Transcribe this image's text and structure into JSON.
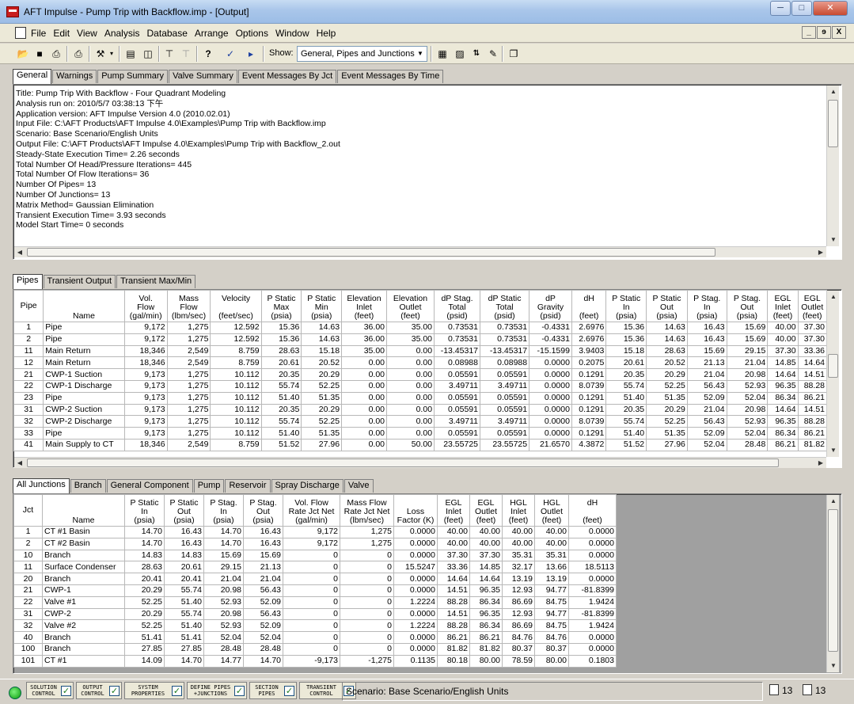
{
  "window": {
    "title": "AFT Impulse - Pump Trip with Backflow.imp - [Output]",
    "controls": [
      "─",
      "□",
      "✕"
    ]
  },
  "menu": [
    "File",
    "Edit",
    "View",
    "Analysis",
    "Database",
    "Arrange",
    "Options",
    "Window",
    "Help"
  ],
  "mdi_controls": [
    "_",
    "ɘ",
    "X"
  ],
  "toolbar": {
    "show_label": "Show:",
    "show_value": "General, Pipes and Junctions"
  },
  "general_tabs": [
    "General",
    "Warnings",
    "Pump Summary",
    "Valve Summary",
    "Event Messages By Jct",
    "Event Messages By Time"
  ],
  "general_text": [
    "Title: Pump Trip With Backflow - Four Quadrant Modeling",
    "Analysis run on: 2010/5/7 03:38:13 下午",
    "Application version: AFT Impulse Version 4.0 (2010.02.01)",
    "Input File: C:\\AFT Products\\AFT Impulse 4.0\\Examples\\Pump Trip with Backflow.imp",
    "Scenario: Base Scenario/English Units",
    "Output File: C:\\AFT Products\\AFT Impulse 4.0\\Examples\\Pump Trip with Backflow_2.out",
    "",
    "Steady-State Execution Time= 2.26 seconds",
    "Total Number Of Head/Pressure Iterations= 445",
    "Total Number Of Flow Iterations= 36",
    "Number Of Pipes= 13",
    "Number Of Junctions= 13",
    "Matrix Method= Gaussian Elimination",
    "",
    "Transient Execution Time= 3.93 seconds",
    "Model Start Time= 0 seconds"
  ],
  "pipe_tabs": [
    "Pipes",
    "Transient Output",
    "Transient Max/Min"
  ],
  "pipe_headers": [
    "Pipe",
    "Name",
    "Vol.\nFlow\n(gal/min)",
    "Mass\nFlow\n(lbm/sec)",
    "Velocity\n\n(feet/sec)",
    "P Static\nMax\n(psia)",
    "P Static\nMin\n(psia)",
    "Elevation\nInlet\n(feet)",
    "Elevation\nOutlet\n(feet)",
    "dP Stag.\nTotal\n(psid)",
    "dP Static\nTotal\n(psid)",
    "dP\nGravity\n(psid)",
    "dH\n\n(feet)",
    "P Static\nIn\n(psia)",
    "P Static\nOut\n(psia)",
    "P Stag.\nIn\n(psia)",
    "P Stag.\nOut\n(psia)",
    "EGL\nInlet\n(feet)",
    "EGL\nOutlet\n(feet)"
  ],
  "pipe_rows": [
    [
      "1",
      "Pipe",
      "9,172",
      "1,275",
      "12.592",
      "15.36",
      "14.63",
      "36.00",
      "35.00",
      "0.73531",
      "0.73531",
      "-0.4331",
      "2.6976",
      "15.36",
      "14.63",
      "16.43",
      "15.69",
      "40.00",
      "37.30"
    ],
    [
      "2",
      "Pipe",
      "9,172",
      "1,275",
      "12.592",
      "15.36",
      "14.63",
      "36.00",
      "35.00",
      "0.73531",
      "0.73531",
      "-0.4331",
      "2.6976",
      "15.36",
      "14.63",
      "16.43",
      "15.69",
      "40.00",
      "37.30"
    ],
    [
      "11",
      "Main Return",
      "18,346",
      "2,549",
      "8.759",
      "28.63",
      "15.18",
      "35.00",
      "0.00",
      "-13.45317",
      "-13.45317",
      "-15.1599",
      "3.9403",
      "15.18",
      "28.63",
      "15.69",
      "29.15",
      "37.30",
      "33.36"
    ],
    [
      "12",
      "Main Return",
      "18,346",
      "2,549",
      "8.759",
      "20.61",
      "20.52",
      "0.00",
      "0.00",
      "0.08988",
      "0.08988",
      "0.0000",
      "0.2075",
      "20.61",
      "20.52",
      "21.13",
      "21.04",
      "14.85",
      "14.64"
    ],
    [
      "21",
      "CWP-1 Suction",
      "9,173",
      "1,275",
      "10.112",
      "20.35",
      "20.29",
      "0.00",
      "0.00",
      "0.05591",
      "0.05591",
      "0.0000",
      "0.1291",
      "20.35",
      "20.29",
      "21.04",
      "20.98",
      "14.64",
      "14.51"
    ],
    [
      "22",
      "CWP-1 Discharge",
      "9,173",
      "1,275",
      "10.112",
      "55.74",
      "52.25",
      "0.00",
      "0.00",
      "3.49711",
      "3.49711",
      "0.0000",
      "8.0739",
      "55.74",
      "52.25",
      "56.43",
      "52.93",
      "96.35",
      "88.28"
    ],
    [
      "23",
      "Pipe",
      "9,173",
      "1,275",
      "10.112",
      "51.40",
      "51.35",
      "0.00",
      "0.00",
      "0.05591",
      "0.05591",
      "0.0000",
      "0.1291",
      "51.40",
      "51.35",
      "52.09",
      "52.04",
      "86.34",
      "86.21"
    ],
    [
      "31",
      "CWP-2 Suction",
      "9,173",
      "1,275",
      "10.112",
      "20.35",
      "20.29",
      "0.00",
      "0.00",
      "0.05591",
      "0.05591",
      "0.0000",
      "0.1291",
      "20.35",
      "20.29",
      "21.04",
      "20.98",
      "14.64",
      "14.51"
    ],
    [
      "32",
      "CWP-2 Discharge",
      "9,173",
      "1,275",
      "10.112",
      "55.74",
      "52.25",
      "0.00",
      "0.00",
      "3.49711",
      "3.49711",
      "0.0000",
      "8.0739",
      "55.74",
      "52.25",
      "56.43",
      "52.93",
      "96.35",
      "88.28"
    ],
    [
      "33",
      "Pipe",
      "9,173",
      "1,275",
      "10.112",
      "51.40",
      "51.35",
      "0.00",
      "0.00",
      "0.05591",
      "0.05591",
      "0.0000",
      "0.1291",
      "51.40",
      "51.35",
      "52.09",
      "52.04",
      "86.34",
      "86.21"
    ],
    [
      "41",
      "Main Supply to CT",
      "18,346",
      "2,549",
      "8.759",
      "51.52",
      "27.96",
      "0.00",
      "50.00",
      "23.55725",
      "23.55725",
      "21.6570",
      "4.3872",
      "51.52",
      "27.96",
      "52.04",
      "28.48",
      "86.21",
      "81.82"
    ]
  ],
  "junction_tabs": [
    "All Junctions",
    "Branch",
    "General Component",
    "Pump",
    "Reservoir",
    "Spray Discharge",
    "Valve"
  ],
  "junction_headers": [
    "Jct",
    "Name",
    "P Static\nIn\n(psia)",
    "P Static\nOut\n(psia)",
    "P Stag.\nIn\n(psia)",
    "P Stag.\nOut\n(psia)",
    "Vol. Flow\nRate Jct Net\n(gal/min)",
    "Mass Flow\nRate Jct Net\n(lbm/sec)",
    "Loss\nFactor (K)",
    "EGL\nInlet\n(feet)",
    "EGL\nOutlet\n(feet)",
    "HGL\nInlet\n(feet)",
    "HGL\nOutlet\n(feet)",
    "dH\n\n(feet)"
  ],
  "junction_rows": [
    [
      "1",
      "CT #1 Basin",
      "14.70",
      "16.43",
      "14.70",
      "16.43",
      "9,172",
      "1,275",
      "0.0000",
      "40.00",
      "40.00",
      "40.00",
      "40.00",
      "0.0000"
    ],
    [
      "2",
      "CT #2 Basin",
      "14.70",
      "16.43",
      "14.70",
      "16.43",
      "9,172",
      "1,275",
      "0.0000",
      "40.00",
      "40.00",
      "40.00",
      "40.00",
      "0.0000"
    ],
    [
      "10",
      "Branch",
      "14.83",
      "14.83",
      "15.69",
      "15.69",
      "0",
      "0",
      "0.0000",
      "37.30",
      "37.30",
      "35.31",
      "35.31",
      "0.0000"
    ],
    [
      "11",
      "Surface Condenser",
      "28.63",
      "20.61",
      "29.15",
      "21.13",
      "0",
      "0",
      "15.5247",
      "33.36",
      "14.85",
      "32.17",
      "13.66",
      "18.5113"
    ],
    [
      "20",
      "Branch",
      "20.41",
      "20.41",
      "21.04",
      "21.04",
      "0",
      "0",
      "0.0000",
      "14.64",
      "14.64",
      "13.19",
      "13.19",
      "0.0000"
    ],
    [
      "21",
      "CWP-1",
      "20.29",
      "55.74",
      "20.98",
      "56.43",
      "0",
      "0",
      "0.0000",
      "14.51",
      "96.35",
      "12.93",
      "94.77",
      "-81.8399"
    ],
    [
      "22",
      "Valve #1",
      "52.25",
      "51.40",
      "52.93",
      "52.09",
      "0",
      "0",
      "1.2224",
      "88.28",
      "86.34",
      "86.69",
      "84.75",
      "1.9424"
    ],
    [
      "31",
      "CWP-2",
      "20.29",
      "55.74",
      "20.98",
      "56.43",
      "0",
      "0",
      "0.0000",
      "14.51",
      "96.35",
      "12.93",
      "94.77",
      "-81.8399"
    ],
    [
      "32",
      "Valve #2",
      "52.25",
      "51.40",
      "52.93",
      "52.09",
      "0",
      "0",
      "1.2224",
      "88.28",
      "86.34",
      "86.69",
      "84.75",
      "1.9424"
    ],
    [
      "40",
      "Branch",
      "51.41",
      "51.41",
      "52.04",
      "52.04",
      "0",
      "0",
      "0.0000",
      "86.21",
      "86.21",
      "84.76",
      "84.76",
      "0.0000"
    ],
    [
      "100",
      "Branch",
      "27.85",
      "27.85",
      "28.48",
      "28.48",
      "0",
      "0",
      "0.0000",
      "81.82",
      "81.82",
      "80.37",
      "80.37",
      "0.0000"
    ],
    [
      "101",
      "CT #1",
      "14.09",
      "14.70",
      "14.77",
      "14.70",
      "-9,173",
      "-1,275",
      "0.1135",
      "80.18",
      "80.00",
      "78.59",
      "80.00",
      "0.1803"
    ]
  ],
  "status": {
    "buttons": [
      [
        "SOLUTION",
        "CONTROL"
      ],
      [
        "OUTPUT",
        "CONTROL"
      ],
      [
        "SYSTEM",
        "PROPERTIES"
      ],
      [
        "DEFINE PIPES",
        "+JUNCTIONS"
      ],
      [
        "SECTION",
        "PIPES"
      ],
      [
        "TRANSIENT",
        "CONTROL"
      ]
    ],
    "scenario": "Scenario: Base Scenario/English Units",
    "pipe_count": "13",
    "junction_count": "13"
  },
  "colors": {
    "title_bar": "#a9c6ea",
    "window_bg": "#d4d0c8",
    "grid_empty": "#a0a0a0",
    "status_led": "#19c019"
  }
}
